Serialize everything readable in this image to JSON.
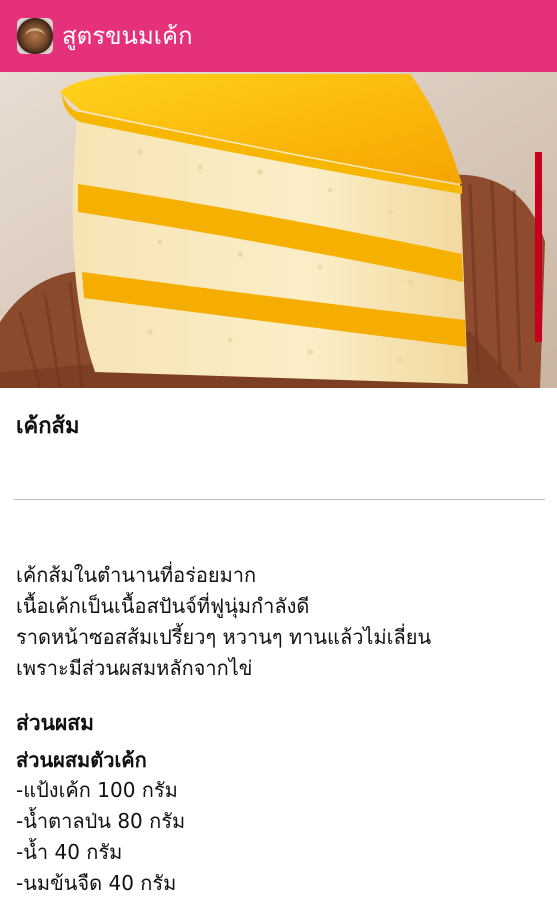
{
  "app": {
    "title": "สูตรขนมเค้ก",
    "icon": "cake-app-icon",
    "bar_color": "#e5317c"
  },
  "hero_image": {
    "subject": "orange-layer-cake-photo",
    "scroll_indicator_color": "#c8001e"
  },
  "recipe": {
    "title": "เค้กส้ม",
    "description": [
      "เค้กส้มในตำนานที่อร่อยมาก",
      "เนื้อเค้กเป็นเนื้อสปันจ์ที่ฟูนุ่มกำลังดี",
      "ราดหน้าซอสส้มเปรี้ยวๆ หวานๆ ทานแล้วไม่เลี่ยน",
      "เพราะมีส่วนผสมหลักจากไข่"
    ],
    "ingredients_heading": "ส่วนผสม",
    "cake_ingredients_heading": "ส่วนผสมตัวเค้ก",
    "cake_ingredients": [
      "-แป้งเค้ก 100 กรัม",
      "-น้ำตาลป่น 80 กรัม",
      "-น้ำ 40 กรัม",
      "-นมข้นจืด 40 กรัม"
    ]
  }
}
